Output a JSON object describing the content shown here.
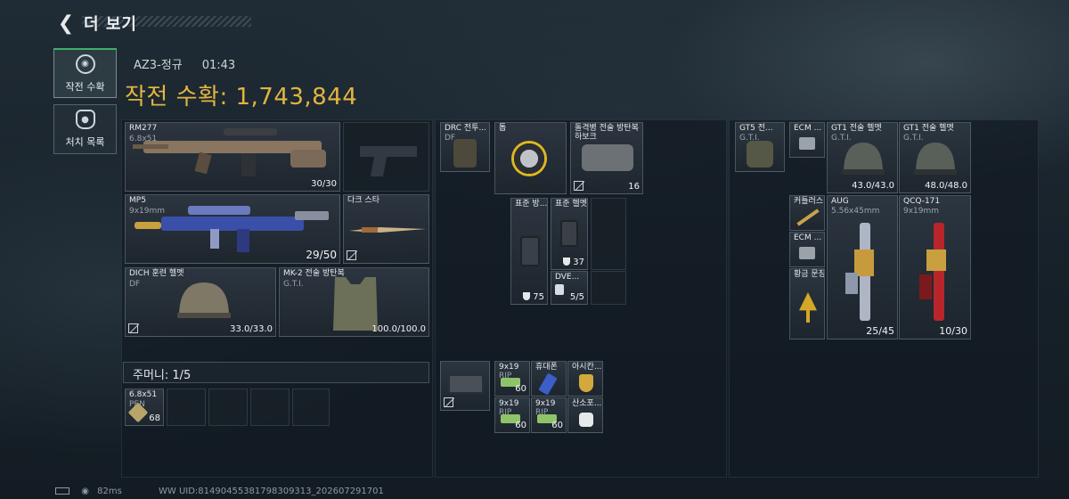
{
  "header": {
    "title": "더 보기",
    "back_icon": "chevron-left-icon"
  },
  "nav": [
    {
      "label": "작전 수확",
      "icon": "target-icon",
      "active": true
    },
    {
      "label": "처치 목록",
      "icon": "skull-icon",
      "active": false
    }
  ],
  "match": {
    "map": "AZ3-정규",
    "time": "01:43"
  },
  "loot_value": "작전 수확: 1,743,844",
  "equipment": {
    "primary": {
      "name": "RM277",
      "sub": "6.8x51",
      "ammo": "30/30"
    },
    "secondary": {
      "name": "MP5",
      "sub": "9x19mm",
      "ammo": "29/50"
    },
    "melee": {
      "name": "다크 스타"
    },
    "helmet": {
      "name": "DICH 훈련 헬멧",
      "sub": "DF",
      "durability": "33.0/33.0"
    },
    "armor": {
      "name": "MK-2 전술 방탄복",
      "sub": "G.T.I.",
      "durability": "100.0/100.0"
    }
  },
  "pocket": {
    "label": "주머니: 1/5",
    "items": [
      {
        "name": "6.8x51",
        "sub": "PEN",
        "count": "68"
      }
    ]
  },
  "rig": {
    "items": [
      {
        "name": "DRC 전투...",
        "sub": "DF"
      },
      {
        "name": "톱"
      },
      {
        "name": "돌격병 전술 방탄복 하보크",
        "count": "16"
      },
      {
        "name": "표준 방..."
      },
      {
        "name": "표준 헬멧",
        "count": "37"
      },
      {
        "name": "DVE...",
        "count": "5/5"
      },
      {
        "name": "",
        "count": "75"
      }
    ]
  },
  "backpack": {
    "items": [
      {
        "name": "9x19",
        "sub": "RIP",
        "count": "60"
      },
      {
        "name": "휴대폰"
      },
      {
        "name": "아시칸..."
      },
      {
        "name": "9x19",
        "sub": "RIP",
        "count": "60"
      },
      {
        "name": "9x19",
        "sub": "RIP",
        "count": "60"
      },
      {
        "name": "산소포..."
      }
    ]
  },
  "stash": {
    "items": [
      {
        "name": "GT5 전...",
        "sub": "G.T.I."
      },
      {
        "name": "ECM ..."
      },
      {
        "name": "GT1 전술 헬멧",
        "sub": "G.T.I.",
        "durability": "43.0/43.0"
      },
      {
        "name": "GT1 전술 헬멧",
        "sub": "G.T.I.",
        "durability": "48.0/48.0"
      },
      {
        "name": "커틀러스"
      },
      {
        "name": "ECM ..."
      },
      {
        "name": "황금 문장"
      },
      {
        "name": "AUG",
        "sub": "5.56x45mm",
        "ammo": "25/45"
      },
      {
        "name": "QCQ-171",
        "sub": "9x19mm",
        "ammo": "10/30"
      }
    ]
  },
  "footer": {
    "ping": "82ms",
    "uid": "WW UID:81490455381798309313_202607291701"
  },
  "colors": {
    "accent_gold": "#e2b441",
    "active_green": "#3fae6a"
  }
}
